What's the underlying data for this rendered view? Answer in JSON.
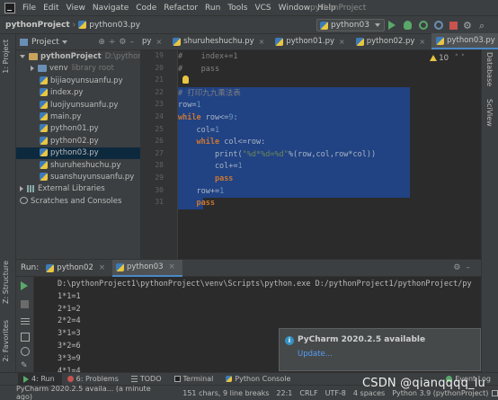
{
  "menubar": {
    "items": [
      "File",
      "Edit",
      "View",
      "Navigate",
      "Code",
      "Refactor",
      "Run",
      "Tools",
      "VCS",
      "Window",
      "Help"
    ],
    "window_title": "pythonProject"
  },
  "navbar": {
    "project": "pythonProject",
    "file": "python03.py",
    "run_config": "python03"
  },
  "left_strip": {
    "project_tab": "1: Project",
    "structure_tab": "Z: Structure",
    "favorites_tab": "2: Favorites"
  },
  "right_strip": {
    "database_tab": "Database",
    "sciview_tab": "SciView"
  },
  "project_panel": {
    "title": "Project",
    "tree": [
      {
        "label": "pythonProject",
        "hint": "D:\\pythonP",
        "indent": 0,
        "kind": "folder-root",
        "arrow": "down"
      },
      {
        "label": "venv",
        "hint": "library root",
        "indent": 1,
        "kind": "folder",
        "arrow": "right"
      },
      {
        "label": "bijiaoyunsuanfu.py",
        "indent": 2,
        "kind": "py"
      },
      {
        "label": "index.py",
        "indent": 2,
        "kind": "py"
      },
      {
        "label": "luojiyunsuanfu.py",
        "indent": 2,
        "kind": "py"
      },
      {
        "label": "main.py",
        "indent": 2,
        "kind": "py"
      },
      {
        "label": "python01.py",
        "indent": 2,
        "kind": "py"
      },
      {
        "label": "python02.py",
        "indent": 2,
        "kind": "py"
      },
      {
        "label": "python03.py",
        "indent": 2,
        "kind": "py",
        "selected": true
      },
      {
        "label": "shuruheshuchu.py",
        "indent": 2,
        "kind": "py"
      },
      {
        "label": "suanshuyunsuanfu.py",
        "indent": 2,
        "kind": "py"
      },
      {
        "label": "External Libraries",
        "indent": 0,
        "kind": "bars",
        "arrow": "right"
      },
      {
        "label": "Scratches and Consoles",
        "indent": 0,
        "kind": "scratch"
      }
    ]
  },
  "editor_tabs": [
    {
      "label": "py",
      "cut": true
    },
    {
      "label": "shuruheshuchu.py"
    },
    {
      "label": "python01.py"
    },
    {
      "label": "python02.py"
    },
    {
      "label": "python03.py",
      "active": true
    }
  ],
  "editor": {
    "warning_count": "10",
    "line_numbers": [
      "19",
      "20",
      "21",
      "22",
      "23",
      "24",
      "25",
      "26",
      "27",
      "28",
      "29",
      "30",
      "31"
    ],
    "lines": [
      "#    index+=1",
      "#    pass",
      "",
      "# 打印九九乘法表",
      "row=1",
      "while row<=9:",
      "    col=1",
      "    while col<=row:",
      "        print(\"%d*%d=%d\"%(row,col,row*col))",
      "        col+=1",
      "        pass",
      "    row+=1",
      "    pass"
    ]
  },
  "run_panel": {
    "label": "Run:",
    "tabs": [
      {
        "label": "python02"
      },
      {
        "label": "python03",
        "active": true
      }
    ],
    "output": [
      "D:\\pythonProject1\\pythonProject\\venv\\Scripts\\python.exe D:/pythonProject1/pythonProject/py",
      "1*1=1",
      "2*1=2",
      "2*2=4",
      "3*1=3",
      "3*2=6",
      "3*3=9",
      "4*1=4"
    ]
  },
  "notification": {
    "title": "PyCharm 2020.2.5 available",
    "action": "Update..."
  },
  "tool_tabs": [
    {
      "label": "4: Run",
      "icon": "run",
      "active": true
    },
    {
      "label": "6: Problems",
      "icon": "problems"
    },
    {
      "label": "TODO",
      "icon": "todo"
    },
    {
      "label": "Terminal",
      "icon": "terminal"
    },
    {
      "label": "Python Console",
      "icon": "python-console"
    },
    {
      "label": "Event Log",
      "icon": "event-log",
      "right": true
    }
  ],
  "statusbar": {
    "message": "PyCharm 2020.2.5 availa... (a minute ago)",
    "selection": "151 chars, 9 line breaks",
    "position": "22:1",
    "line_sep": "CRLF",
    "encoding": "UTF-8",
    "indent": "4 spaces",
    "interpreter": "Python 3.9 (pythonProject)"
  },
  "watermark": "CSDN @qianqqqq_lu"
}
